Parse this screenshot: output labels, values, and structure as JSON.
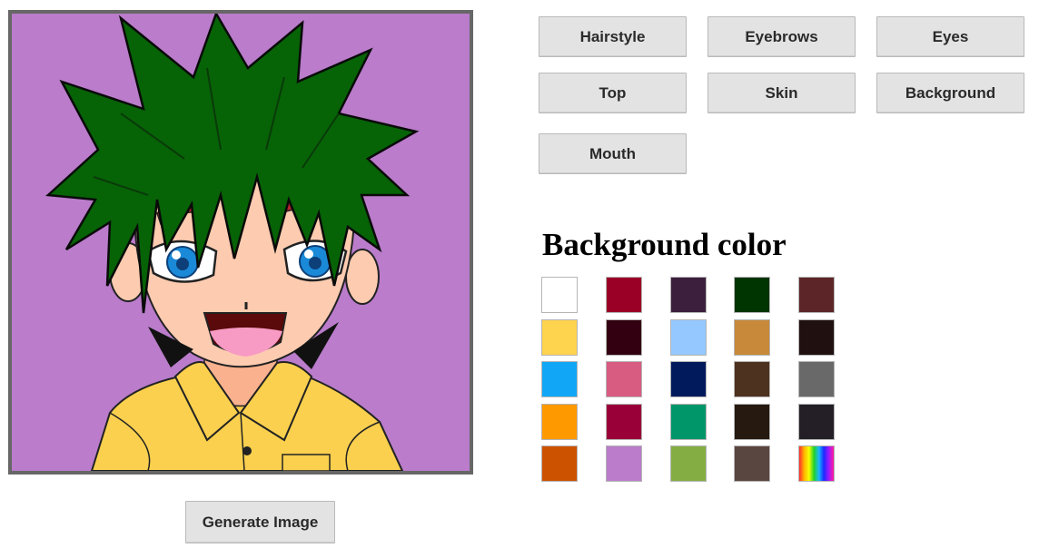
{
  "categories": [
    {
      "id": "hairstyle",
      "label": "Hairstyle"
    },
    {
      "id": "eyebrows",
      "label": "Eyebrows"
    },
    {
      "id": "eyes",
      "label": "Eyes"
    },
    {
      "id": "top",
      "label": "Top"
    },
    {
      "id": "skin",
      "label": "Skin"
    },
    {
      "id": "background",
      "label": "Background"
    },
    {
      "id": "mouth",
      "label": "Mouth"
    }
  ],
  "panel": {
    "title": "Background color"
  },
  "swatches": [
    [
      "#ffffff",
      "#9a0025",
      "#3c1f3c",
      "#003400",
      "#5c2629"
    ],
    [
      "#fed34e",
      "#320010",
      "#94c8fe",
      "#c8893a",
      "#201010"
    ],
    [
      "#12a7f6",
      "#d85c82",
      "#001a5c",
      "#4e3220",
      "#696969"
    ],
    [
      "#ff9900",
      "#990038",
      "#009669",
      "#261a10",
      "#241f26"
    ],
    [
      "#cc5200",
      "#ba7ccb",
      "#84ae44",
      "#5a4640",
      "rainbow"
    ]
  ],
  "actions": {
    "generate_label": "Generate Image"
  },
  "avatar": {
    "background_color": "#ba7ccb",
    "hair_color": "#066306",
    "skin_color": "#fdcbb0",
    "eyebrow_color": "#b8232e",
    "eye_color": "#1a8ad8",
    "shirt_color": "#fad04e"
  }
}
